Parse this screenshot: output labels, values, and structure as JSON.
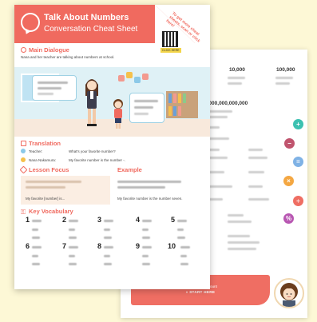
{
  "front": {
    "title_line1": "Talk About Numbers",
    "title_line2": "Conversation Cheat Sheet",
    "corner_text": "To get more cheat sheets, scan or click here!",
    "qr_label": "CLICK HERE",
    "main_dialogue": {
      "title": "Main Dialogue",
      "subtitle": "Nana and her teacher are talking about numbers at school."
    },
    "translation": {
      "title": "Translation",
      "rows": [
        {
          "speaker": "Teacher:",
          "line": "What's your favorite number?"
        },
        {
          "speaker": "Nana Nakamura:",
          "line": "My favorite number is the number -."
        }
      ]
    },
    "lesson_focus": {
      "title": "Lesson Focus",
      "text": "My favorite [number] is..."
    },
    "example": {
      "title": "Example",
      "text": "My favorite number is the number seven."
    },
    "vocabulary": {
      "title": "Key Vocabulary",
      "numbers": [
        "1",
        "2",
        "3",
        "4",
        "5",
        "6",
        "7",
        "8",
        "9",
        "10"
      ]
    }
  },
  "back": {
    "top_numbers": [
      "10,000",
      "100,000"
    ],
    "big_number": "1,000,000,000,000",
    "cta_line1": "Learn How To Count",
    "cta_line2": "» START HERE",
    "operator_icons": [
      {
        "symbol": "+",
        "color": "#3cc1b1"
      },
      {
        "symbol": "−",
        "color": "#c0546e"
      },
      {
        "symbol": "=",
        "color": "#7fb2e5"
      },
      {
        "symbol": "×",
        "color": "#f4a742"
      },
      {
        "symbol": "÷",
        "color": "#ef6e63"
      },
      {
        "symbol": "%",
        "color": "#b857b2"
      }
    ]
  }
}
